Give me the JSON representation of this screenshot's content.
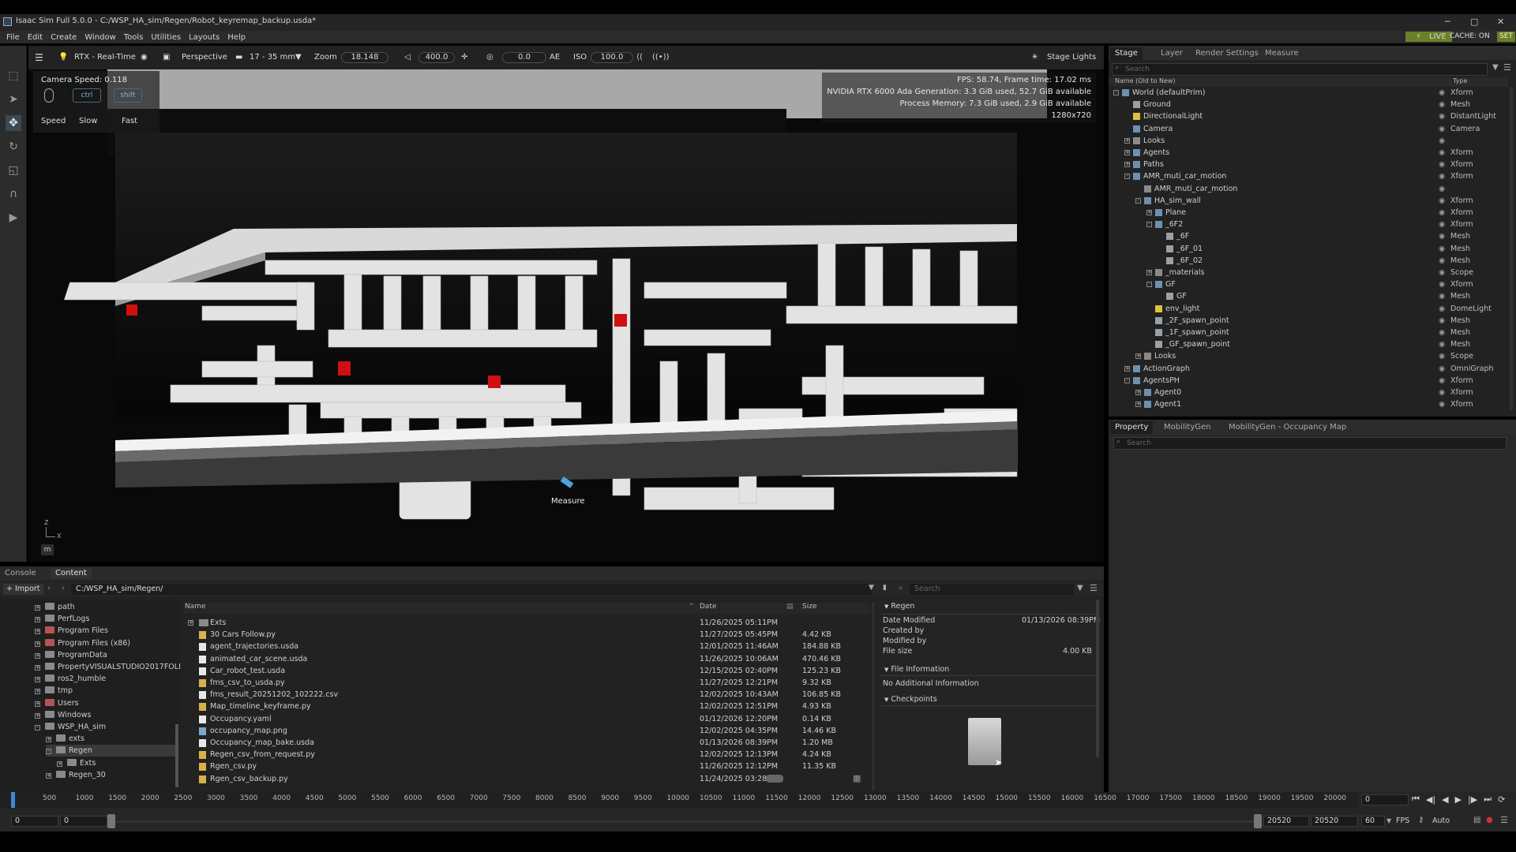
{
  "window": {
    "title": "Isaac Sim Full 5.0.0 - C:/WSP_HA_sim/Regen/Robot_keyremap_backup.usda*",
    "minimize": "─",
    "maximize": "▢",
    "close": "✕"
  },
  "menu": [
    "File",
    "Edit",
    "Create",
    "Window",
    "Tools",
    "Utilities",
    "Layouts",
    "Help"
  ],
  "status": {
    "live": "LIVE",
    "cache": "CACHE: ON",
    "set": "SET"
  },
  "viewport_toolbar": {
    "renderer": "RTX - Real-Time",
    "camera": "Perspective",
    "lens": "17 - 35 mm",
    "zoom_label": "Zoom",
    "zoom_value": "18.148",
    "speed_value": "400.0",
    "exposure_value": "0.0",
    "ae_label": "AE",
    "iso_label": "ISO",
    "iso_value": "100.0",
    "stage_lights": "Stage Lights"
  },
  "camera_speed": {
    "label": "Camera Speed:",
    "value": "0.118",
    "ctrl_key": "ctrl",
    "shift_key": "shift",
    "speed_label": "Speed",
    "slow_label": "Slow",
    "fast_label": "Fast"
  },
  "stats": {
    "fps": "FPS: 58.74, Frame time: 17.02 ms",
    "gpu": "NVIDIA RTX 6000 Ada Generation: 3.3 GiB used, 52.7 GiB available",
    "memory": "Process Memory: 7.3 GiB used, 2.9 GiB available",
    "resolution": "1280x720"
  },
  "viewport": {
    "measure_label": "Measure",
    "axis_z": "Z",
    "axis_x": "X",
    "units_label": "m"
  },
  "stage": {
    "tabs": [
      "Stage",
      "Layer",
      "Render Settings",
      "Measure"
    ],
    "search_placeholder": "Search",
    "col_name": "Name (Old to New)",
    "col_type": "Type",
    "rows": [
      {
        "name": "World (defaultPrim)",
        "type": "Xform"
      },
      {
        "name": "Ground",
        "type": "Mesh"
      },
      {
        "name": "DirectionalLight",
        "type": "DistantLight"
      },
      {
        "name": "Camera",
        "type": "Camera"
      },
      {
        "name": "Looks",
        "type": ""
      },
      {
        "name": "Agents",
        "type": "Xform"
      },
      {
        "name": "Paths",
        "type": "Xform"
      },
      {
        "name": "AMR_muti_car_motion",
        "type": "Xform"
      },
      {
        "name": "AMR_muti_car_motion",
        "type": ""
      },
      {
        "name": "HA_sim_wall",
        "type": "Xform"
      },
      {
        "name": "Plane",
        "type": "Xform"
      },
      {
        "name": "_6F2",
        "type": "Xform"
      },
      {
        "name": "_6F",
        "type": "Mesh"
      },
      {
        "name": "_6F_01",
        "type": "Mesh"
      },
      {
        "name": "_6F_02",
        "type": "Mesh"
      },
      {
        "name": "_materials",
        "type": "Scope"
      },
      {
        "name": "GF",
        "type": "Xform"
      },
      {
        "name": "GF",
        "type": "Mesh"
      },
      {
        "name": "env_light",
        "type": "DomeLight"
      },
      {
        "name": "_2F_spawn_point",
        "type": "Mesh"
      },
      {
        "name": "_1F_spawn_point",
        "type": "Mesh"
      },
      {
        "name": "_GF_spawn_point",
        "type": "Mesh"
      },
      {
        "name": "Looks",
        "type": "Scope"
      },
      {
        "name": "ActionGraph",
        "type": "OmniGraph"
      },
      {
        "name": "AgentsPH",
        "type": "Xform"
      },
      {
        "name": "Agent0",
        "type": "Xform"
      },
      {
        "name": "Agent1",
        "type": "Xform"
      }
    ]
  },
  "property": {
    "tabs": [
      "Property",
      "MobilityGen",
      "MobilityGen - Occupancy Map"
    ],
    "search_placeholder": "Search"
  },
  "content": {
    "tabs": [
      "Console",
      "Content"
    ],
    "import_label": "Import",
    "path": "C:/WSP_HA_sim/Regen/",
    "search_placeholder": "Search",
    "col_name": "Name",
    "col_date": "Date",
    "col_size": "Size",
    "folders": [
      {
        "name": "path",
        "depth": 0
      },
      {
        "name": "PerfLogs",
        "depth": 0
      },
      {
        "name": "Program Files",
        "depth": 0
      },
      {
        "name": "Program Files (x86)",
        "depth": 0
      },
      {
        "name": "ProgramData",
        "depth": 0
      },
      {
        "name": "PropertyVISUALSTUDIO2017FOLDE",
        "depth": 0
      },
      {
        "name": "ros2_humble",
        "depth": 0
      },
      {
        "name": "tmp",
        "depth": 0
      },
      {
        "name": "Users",
        "depth": 0
      },
      {
        "name": "Windows",
        "depth": 0
      },
      {
        "name": "WSP_HA_sim",
        "depth": 0
      },
      {
        "name": "exts",
        "depth": 1
      },
      {
        "name": "Regen",
        "depth": 1
      },
      {
        "name": "Exts",
        "depth": 2
      },
      {
        "name": "Regen_30",
        "depth": 1
      }
    ],
    "files": [
      {
        "name": "Exts",
        "date": "11/26/2025 05:11PM",
        "size": ""
      },
      {
        "name": "30 Cars Follow.py",
        "date": "11/27/2025 05:45PM",
        "size": "4.42 KB"
      },
      {
        "name": "agent_trajectories.usda",
        "date": "12/01/2025 11:46AM",
        "size": "184.88 KB"
      },
      {
        "name": "animated_car_scene.usda",
        "date": "11/26/2025 10:06AM",
        "size": "470.46 KB"
      },
      {
        "name": "Car_robot_test.usda",
        "date": "12/15/2025 02:40PM",
        "size": "125.23 KB"
      },
      {
        "name": "fms_csv_to_usda.py",
        "date": "11/27/2025 12:21PM",
        "size": "9.32 KB"
      },
      {
        "name": "fms_result_20251202_102222.csv",
        "date": "12/02/2025 10:43AM",
        "size": "106.85 KB"
      },
      {
        "name": "Map_timeline_keyframe.py",
        "date": "12/02/2025 12:51PM",
        "size": "4.93 KB"
      },
      {
        "name": "Occupancy.yaml",
        "date": "01/12/2026 12:20PM",
        "size": "0.14 KB"
      },
      {
        "name": "occupancy_map.png",
        "date": "12/02/2025 04:35PM",
        "size": "14.46 KB"
      },
      {
        "name": "Occupancy_map_bake.usda",
        "date": "01/13/2026 08:39PM",
        "size": "1.20 MB"
      },
      {
        "name": "Regen_csv_from_request.py",
        "date": "12/02/2025 12:13PM",
        "size": "4.24 KB"
      },
      {
        "name": "Rgen_csv.py",
        "date": "11/26/2025 12:12PM",
        "size": "11.35 KB"
      },
      {
        "name": "Rgen_csv_backup.py",
        "date": "11/24/2025 03:28P",
        "size": ""
      }
    ],
    "detail": {
      "title": "Regen",
      "date_modified_label": "Date Modified",
      "date_modified": "01/13/2026 08:39PM",
      "created_by_label": "Created by",
      "modified_by_label": "Modified by",
      "file_size_label": "File size",
      "file_size": "4.00 KB",
      "file_info_label": "File Information",
      "no_info": "No Additional Information",
      "checkpoints_label": "Checkpoints"
    }
  },
  "timeline": {
    "ticks": [
      "500",
      "1000",
      "1500",
      "2000",
      "2500",
      "3000",
      "3500",
      "4000",
      "4500",
      "5000",
      "5500",
      "6000",
      "6500",
      "7000",
      "7500",
      "8000",
      "8500",
      "9000",
      "9500",
      "10000",
      "10500",
      "11000",
      "11500",
      "12000",
      "12500",
      "13000",
      "13500",
      "14000",
      "14500",
      "15000",
      "15500",
      "16000",
      "16500",
      "17000",
      "17500",
      "18000",
      "18500",
      "19000",
      "19500",
      "20000"
    ],
    "current_frame": "0",
    "start": "0",
    "start2": "0",
    "end": "20520",
    "end2": "20520",
    "fps_value": "60",
    "fps_label": "FPS",
    "auto_label": "Auto"
  },
  "colors": {
    "accent": "#3d6e8c",
    "live": "#6b7f2a",
    "box_red": "#d01010"
  }
}
